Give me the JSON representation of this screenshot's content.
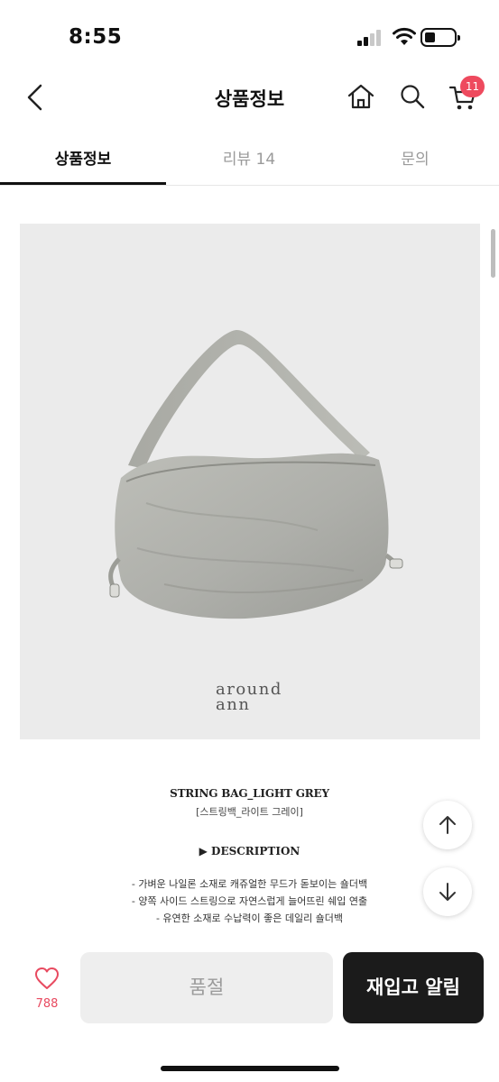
{
  "status_bar": {
    "time": "8:55"
  },
  "header": {
    "title": "상품정보",
    "cart_count": "11"
  },
  "tabs": [
    {
      "label": "상품정보",
      "active": true
    },
    {
      "label": "리뷰 14",
      "active": false
    },
    {
      "label": "문의",
      "active": false
    }
  ],
  "product_image": {
    "brand_line1": "around",
    "brand_line2": "ann",
    "bag_color": "#b2b3ad",
    "background": "#ebebeb"
  },
  "description": {
    "name": "STRING BAG_LIGHT GREY",
    "subtitle": "[스트링백_라이트 그레이]",
    "section_heading": "▶ DESCRIPTION",
    "bullets": [
      "- 가벼운 나일론 소재로 캐쥬얼한 무드가 돋보이는 숄더백",
      "- 양쪽 사이드 스트링으로 자연스럽게 늘어뜨린 쉐입 연출",
      "- 유연한 소재로 수납력이 좋은 데일리 숄더백"
    ]
  },
  "bottom_bar": {
    "like_count": "788",
    "soldout_label": "품절",
    "restock_label": "재입고 알림"
  },
  "colors": {
    "accent": "#ee4a5e",
    "button_dark": "#1b1b1b",
    "button_disabled": "#eeeeee"
  }
}
